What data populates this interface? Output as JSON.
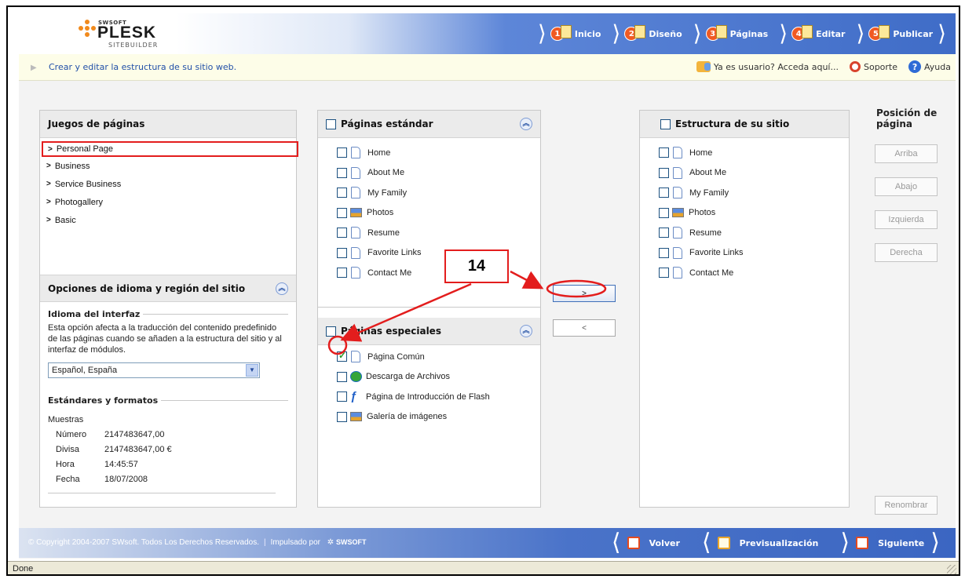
{
  "header": {
    "logo_small": "SWSOFT",
    "logo_main": "PLESK",
    "logo_sub": "SITEBUILDER",
    "steps": [
      {
        "num": "1",
        "label": "Inicio"
      },
      {
        "num": "2",
        "label": "Diseño"
      },
      {
        "num": "3",
        "label": "Páginas"
      },
      {
        "num": "4",
        "label": "Editar"
      },
      {
        "num": "5",
        "label": "Publicar"
      }
    ]
  },
  "subbar": {
    "breadcrumb": "Crear y editar la estructura de su sitio web.",
    "login": "Ya es usuario? Acceda aquí...",
    "support": "Soporte",
    "help": "Ayuda"
  },
  "page_sets": {
    "title": "Juegos de páginas",
    "items": [
      "Personal Page",
      "Business",
      "Service Business",
      "Photogallery",
      "Basic"
    ]
  },
  "language": {
    "title": "Opciones de idioma y región del sitio",
    "interface_title": "Idioma del interfaz",
    "interface_desc": "Esta opción afecta a la traducción del contenido predefinido de las páginas cuando se añaden a la estructura del sitio y al interfaz de módulos.",
    "selected": "Español, España",
    "formats_title": "Estándares y formatos",
    "samples_label": "Muestras",
    "samples": [
      {
        "key": "Número",
        "value": "2147483647,00"
      },
      {
        "key": "Divisa",
        "value": "2147483647,00 €"
      },
      {
        "key": "Hora",
        "value": "14:45:57"
      },
      {
        "key": "Fecha",
        "value": "18/07/2008"
      }
    ]
  },
  "standard_pages": {
    "title": "Páginas estándar",
    "items": [
      "Home",
      "About Me",
      "My Family",
      "Photos",
      "Resume",
      "Favorite Links",
      "Contact Me"
    ]
  },
  "special_pages": {
    "title": "Páginas especiales",
    "items": [
      "Página Común",
      "Descarga de Archivos",
      "Página de Introducción de Flash",
      "Galería de imágenes"
    ]
  },
  "move_buttons": {
    "add": ">",
    "remove": "<"
  },
  "site_structure": {
    "title": "Estructura de su sitio",
    "items": [
      "Home",
      "About Me",
      "My Family",
      "Photos",
      "Resume",
      "Favorite Links",
      "Contact Me"
    ]
  },
  "position": {
    "title_line1": "Posición de",
    "title_line2": "página",
    "up": "Arriba",
    "down": "Abajo",
    "left": "Izquierda",
    "right": "Derecha",
    "rename": "Renombrar"
  },
  "footer": {
    "copyright": "© Copyright 2004-2007 SWsoft. Todos Los Derechos Reservados.",
    "powered": "Impulsado por",
    "powered_brand": "SWSOFT",
    "back": "Volver",
    "preview": "Previsualización",
    "next": "Siguiente"
  },
  "statusbar": {
    "text": "Done"
  },
  "annotation": {
    "number": "14"
  },
  "colors": {
    "accent": "#3f6cc7",
    "highlight": "#e31d1d",
    "brand_orange": "#f05a23"
  }
}
